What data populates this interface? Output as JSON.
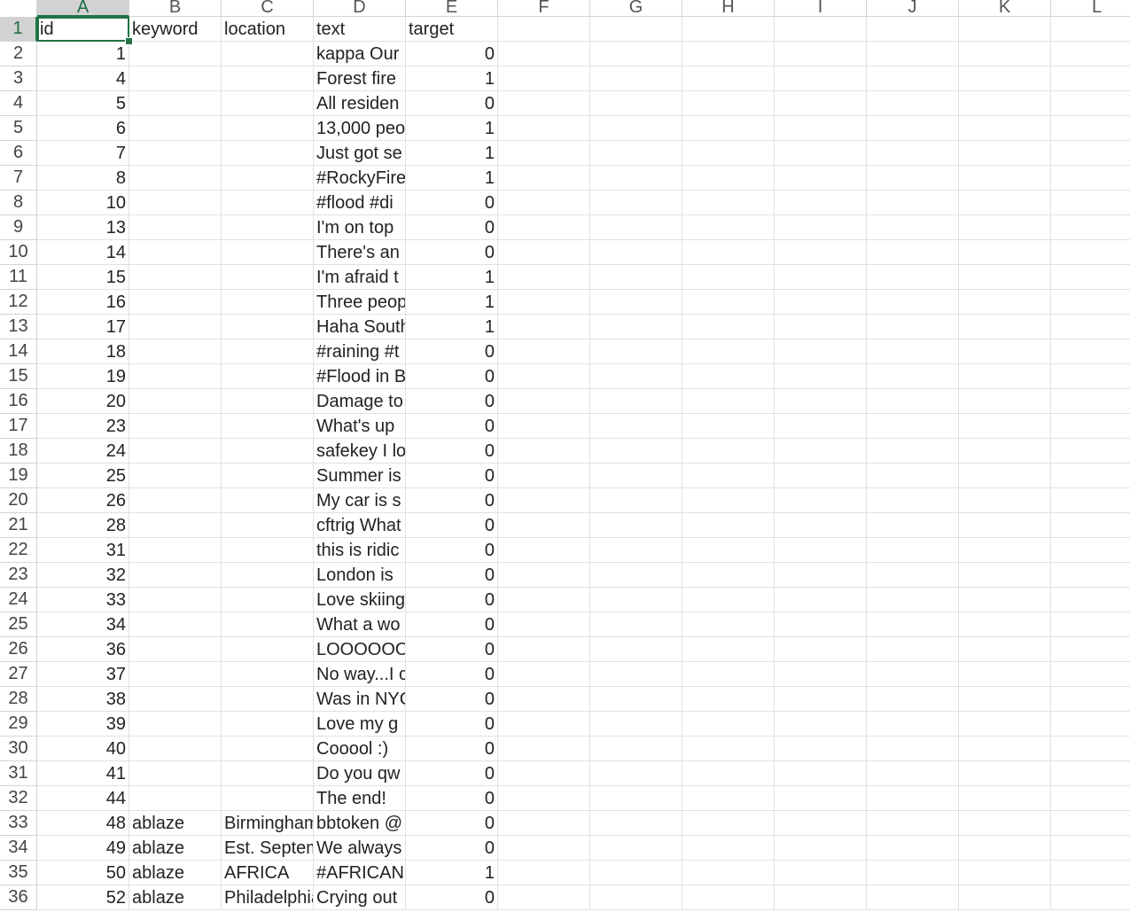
{
  "spreadsheet": {
    "columns": [
      "A",
      "B",
      "C",
      "D",
      "E",
      "F",
      "G",
      "H",
      "I",
      "J",
      "K",
      "L"
    ],
    "selected_cell": "A1",
    "selected_column": "A",
    "selected_row": "1",
    "accent_color": "#217346",
    "header_row": [
      "id",
      "keyword",
      "location",
      "text",
      "target"
    ],
    "rows": [
      [
        "1",
        "",
        "",
        "kappa Our",
        "0"
      ],
      [
        "4",
        "",
        "",
        "Forest fire",
        "1"
      ],
      [
        "5",
        "",
        "",
        "All residen",
        "0"
      ],
      [
        "6",
        "",
        "",
        "13,000 peo",
        "1"
      ],
      [
        "7",
        "",
        "",
        "Just got se",
        "1"
      ],
      [
        "8",
        "",
        "",
        "#RockyFire",
        "1"
      ],
      [
        "10",
        "",
        "",
        "#flood #di",
        "0"
      ],
      [
        "13",
        "",
        "",
        "I'm on top",
        "0"
      ],
      [
        "14",
        "",
        "",
        "There's an",
        "0"
      ],
      [
        "15",
        "",
        "",
        "I'm afraid t",
        "1"
      ],
      [
        "16",
        "",
        "",
        "Three peop",
        "1"
      ],
      [
        "17",
        "",
        "",
        "Haha South",
        "1"
      ],
      [
        "18",
        "",
        "",
        "#raining #t",
        "0"
      ],
      [
        "19",
        "",
        "",
        "#Flood in B",
        "0"
      ],
      [
        "20",
        "",
        "",
        "Damage to",
        "0"
      ],
      [
        "23",
        "",
        "",
        "What's up",
        "0"
      ],
      [
        "24",
        "",
        "",
        "safekey I lo",
        "0"
      ],
      [
        "25",
        "",
        "",
        "Summer is",
        "0"
      ],
      [
        "26",
        "",
        "",
        "My car is s",
        "0"
      ],
      [
        "28",
        "",
        "",
        "cftrig What",
        "0"
      ],
      [
        "31",
        "",
        "",
        "this is ridic",
        "0"
      ],
      [
        "32",
        "",
        "",
        "London is",
        "0"
      ],
      [
        "33",
        "",
        "",
        "Love skiing",
        "0"
      ],
      [
        "34",
        "",
        "",
        "What a wo",
        "0"
      ],
      [
        "36",
        "",
        "",
        "LOOOOOO",
        "0"
      ],
      [
        "37",
        "",
        "",
        "No way...I c",
        "0"
      ],
      [
        "38",
        "",
        "",
        "Was in NYC",
        "0"
      ],
      [
        "39",
        "",
        "",
        "Love my g",
        "0"
      ],
      [
        "40",
        "",
        "",
        "Cooool :)",
        "0"
      ],
      [
        "41",
        "",
        "",
        "Do you qw",
        "0"
      ],
      [
        "44",
        "",
        "",
        "The end!",
        "0"
      ],
      [
        "48",
        "ablaze",
        "Birmingham",
        "bbtoken @",
        "0"
      ],
      [
        "49",
        "ablaze",
        "Est. September",
        "We always",
        "0"
      ],
      [
        "50",
        "ablaze",
        "AFRICA",
        "#AFRICAN",
        "1"
      ],
      [
        "52",
        "ablaze",
        "Philadelphia",
        "Crying out",
        "0"
      ]
    ]
  }
}
